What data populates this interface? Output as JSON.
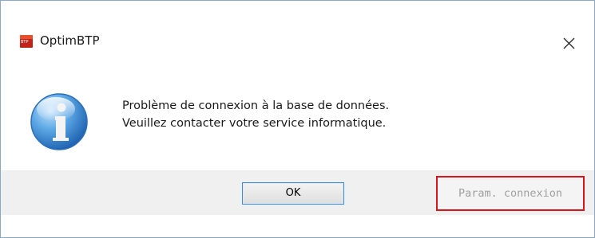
{
  "window": {
    "title": "OptimBTP",
    "app_icon_text": "BTP"
  },
  "dialog": {
    "message_line1": "Problème de connexion à la base de données.",
    "message_line2": "Veuillez contacter votre service informatique.",
    "icon": "information-icon"
  },
  "buttons": {
    "ok_label": "OK",
    "param_label": "Param. connexion"
  },
  "colors": {
    "app_icon": "#c0231a",
    "ok_border": "#3c8ad9",
    "highlight_border": "#d9141c",
    "disabled_text": "#a0a0a0"
  }
}
